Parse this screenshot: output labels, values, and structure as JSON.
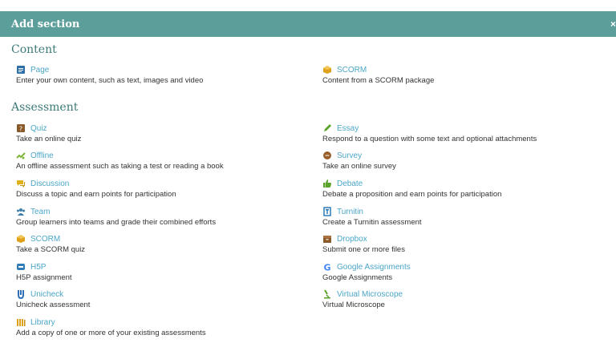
{
  "header": {
    "title": "Add section",
    "close": "×"
  },
  "content": {
    "title": "Content",
    "items": [
      {
        "label": "Page",
        "desc": "Enter your own content, such as text, images and video",
        "icon": "page-icon",
        "color": "#2e6fa8"
      },
      {
        "label": "SCORM",
        "desc": "Content from a SCORM package",
        "icon": "scorm-icon",
        "color": "#e0a11a"
      }
    ]
  },
  "assessment": {
    "title": "Assessment",
    "left": [
      {
        "label": "Quiz",
        "desc": "Take an online quiz",
        "icon": "quiz-icon",
        "color": "#8a5a2b"
      },
      {
        "label": "Offline",
        "desc": "An offline assessment such as taking a test or reading a book",
        "icon": "offline-icon",
        "color": "#7fb43a"
      },
      {
        "label": "Discussion",
        "desc": "Discuss a topic and earn points for participation",
        "icon": "discussion-icon",
        "color": "#e0b21a"
      },
      {
        "label": "Team",
        "desc": "Group learners into teams and grade their combined efforts",
        "icon": "team-icon",
        "color": "#3b7ea8"
      },
      {
        "label": "SCORM",
        "desc": "Take a SCORM quiz",
        "icon": "scorm-icon",
        "color": "#e0a11a"
      },
      {
        "label": "H5P",
        "desc": "H5P assignment",
        "icon": "h5p-icon",
        "color": "#2f7db8"
      },
      {
        "label": "Unicheck",
        "desc": "Unicheck assessment",
        "icon": "unicheck-icon",
        "color": "#2e6fb8"
      },
      {
        "label": "Library",
        "desc": "Add a copy of one or more of your existing assessments",
        "icon": "library-icon",
        "color": "#e0a11a"
      }
    ],
    "right": [
      {
        "label": "Essay",
        "desc": "Respond to a question with some text and optional attachments",
        "icon": "pen-icon",
        "color": "#5aa32b"
      },
      {
        "label": "Survey",
        "desc": "Take an online survey",
        "icon": "survey-icon",
        "color": "#9a5e2b"
      },
      {
        "label": "Debate",
        "desc": "Debate a proposition and earn points for participation",
        "icon": "thumbs-up-icon",
        "color": "#5aa32b"
      },
      {
        "label": "Turnitin",
        "desc": "Create a Turnitin assessment",
        "icon": "turnitin-icon",
        "color": "#2f7db8"
      },
      {
        "label": "Dropbox",
        "desc": "Submit one or more files",
        "icon": "dropbox-icon",
        "color": "#8a5a2b"
      },
      {
        "label": "Google Assignments",
        "desc": "Google Assignments",
        "icon": "google-icon",
        "color": "#4285f4"
      },
      {
        "label": "Virtual Microscope",
        "desc": "Virtual Microscope",
        "icon": "microscope-icon",
        "color": "#5aa32b"
      }
    ]
  }
}
